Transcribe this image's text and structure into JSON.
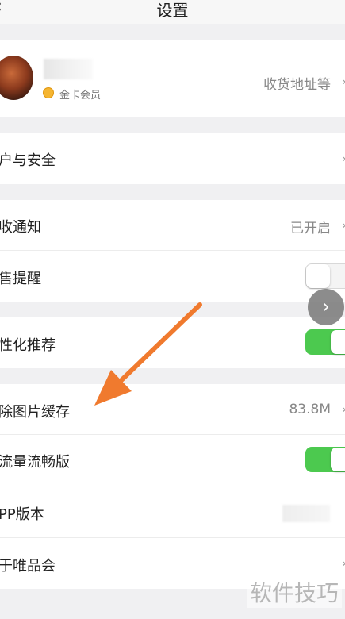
{
  "nav": {
    "title": "设置",
    "back": "‹"
  },
  "profile": {
    "badge": "金卡会员",
    "address": "收货地址等"
  },
  "rows": {
    "account": "户与安全",
    "notify": "收通知",
    "notify_value": "已开启",
    "sale": "售提醒",
    "personal": "性化推荐",
    "cache": "除图片缓存",
    "cache_value": "83.8M",
    "lite": "流量流畅版",
    "app": "PP版本",
    "about": "于唯品会"
  },
  "toggles": {
    "sale": "off",
    "personal": "on",
    "lite": "on"
  },
  "float_button": "›",
  "watermark": "软件技巧",
  "colors": {
    "toggle_on": "#4cc94f",
    "annotation_arrow": "#f07a2e"
  }
}
